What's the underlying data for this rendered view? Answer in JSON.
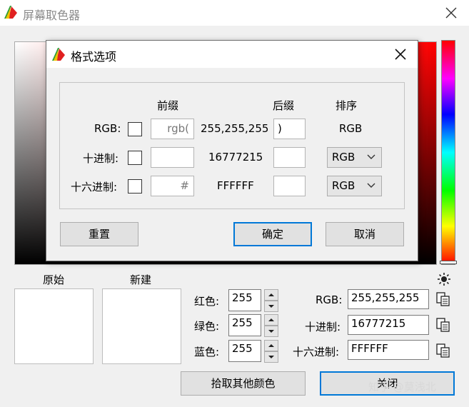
{
  "main": {
    "title": "屏幕取色器",
    "original_label": "原始",
    "new_label": "新建",
    "red_label": "红色:",
    "green_label": "绿色:",
    "blue_label": "蓝色:",
    "red_value": "255",
    "green_value": "255",
    "blue_value": "255",
    "rgb_label": "RGB:",
    "decimal_label": "十进制:",
    "hex_label": "十六进制:",
    "rgb_value": "255,255,255",
    "decimal_value": "16777215",
    "hex_value": "FFFFFF",
    "pick_button": "拾取其他颜色",
    "close_button": "关闭",
    "watermark": "知乎 @莫浅北",
    "current_color": "#ffffff"
  },
  "dialog": {
    "title": "格式选项",
    "header_prefix": "前缀",
    "header_suffix": "后缀",
    "header_order": "排序",
    "rows": [
      {
        "label": "RGB:",
        "prefix": "rgb(",
        "value": "255,255,255",
        "suffix": ")",
        "order": "RGB"
      },
      {
        "label": "十进制:",
        "prefix": "",
        "value": "16777215",
        "suffix": "",
        "order": "RGB"
      },
      {
        "label": "十六进制:",
        "prefix": "#",
        "value": "FFFFFF",
        "suffix": "",
        "order": "RGB"
      }
    ],
    "reset_button": "重置",
    "ok_button": "确定",
    "cancel_button": "取消"
  }
}
